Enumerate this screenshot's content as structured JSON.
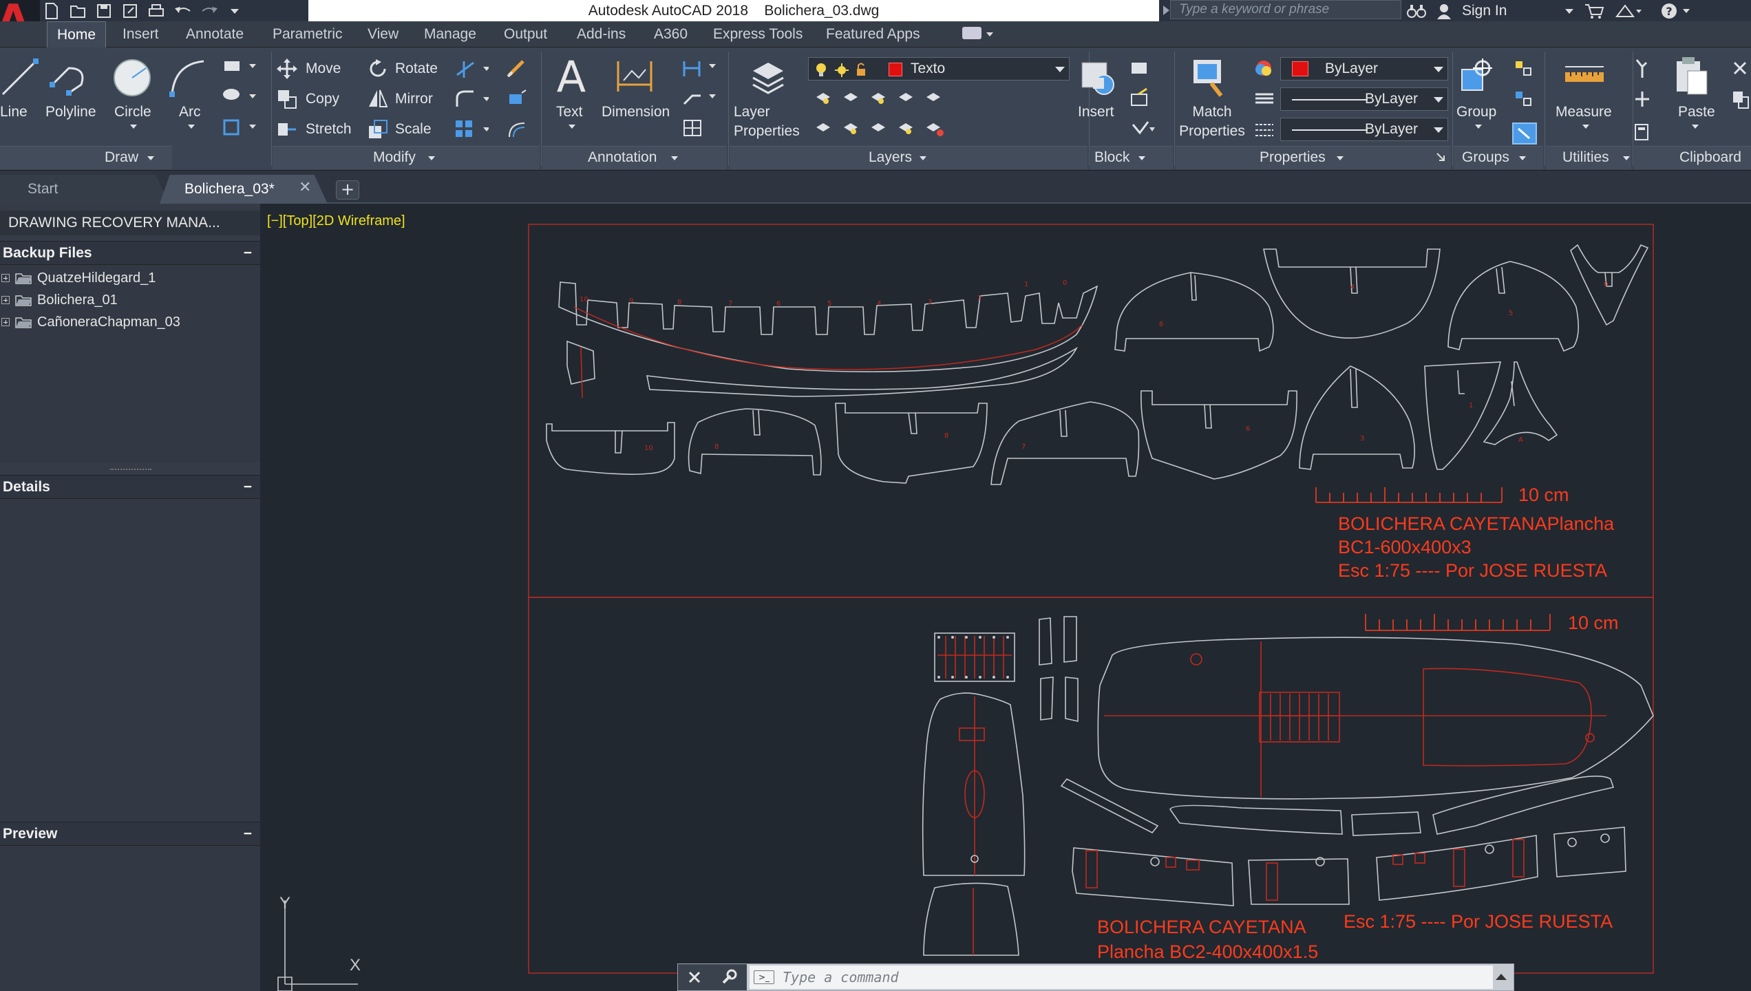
{
  "titlebar": {
    "title": "Autodesk AutoCAD 2018    Bolichera_03.dwg",
    "search_placeholder": "Type a keyword or phrase",
    "sign_in": "Sign In"
  },
  "ribbon_tabs": [
    "Home",
    "Insert",
    "Annotate",
    "Parametric",
    "View",
    "Manage",
    "Output",
    "Add-ins",
    "A360",
    "Express Tools",
    "Featured Apps"
  ],
  "ribbon": {
    "draw": {
      "label": "Draw",
      "line": "Line",
      "polyline": "Polyline",
      "circle": "Circle",
      "arc": "Arc"
    },
    "modify": {
      "label": "Modify",
      "move": "Move",
      "rotate": "Rotate",
      "copy": "Copy",
      "mirror": "Mirror",
      "stretch": "Stretch",
      "scale": "Scale"
    },
    "annotation": {
      "label": "Annotation",
      "text": "Text",
      "dimension": "Dimension"
    },
    "layers": {
      "label": "Layers",
      "layer_properties_1": "Layer",
      "layer_properties_2": "Properties",
      "current_layer": "Texto"
    },
    "block": {
      "label": "Block",
      "insert": "Insert"
    },
    "properties": {
      "label": "Properties",
      "match_1": "Match",
      "match_2": "Properties",
      "color": "ByLayer",
      "linetype": "ByLayer",
      "lineweight": "ByLayer"
    },
    "groups": {
      "label": "Groups",
      "group": "Group"
    },
    "utilities": {
      "label": "Utilities",
      "measure": "Measure"
    },
    "clipboard": {
      "label": "Clipboard",
      "paste": "Paste"
    }
  },
  "file_tabs": {
    "start": "Start",
    "current": "Bolichera_03*"
  },
  "palette": {
    "title": "DRAWING RECOVERY MANA...",
    "backup_header": "Backup Files",
    "backup_items": [
      "QuatzeHildegard_1",
      "Bolichera_01",
      "CañoneraChapman_03"
    ],
    "details_header": "Details",
    "preview_header": "Preview",
    "collapse": "−"
  },
  "viewport": {
    "label": "[−][Top][2D Wireframe]"
  },
  "drawing": {
    "sheet1_scale": "10 cm",
    "sheet1_title_1": "BOLICHERA CAYETANAPlancha",
    "sheet1_title_2": "BC1-600x400x3",
    "sheet1_title_3": "Esc 1:75 ---- Por JOSE RUESTA",
    "sheet2_scale": "10 cm",
    "sheet2_title_1": "BOLICHERA CAYETANA",
    "sheet2_title_2": "Plancha BC2-400x400x1.5",
    "sheet2_title_3": "Esc 1:75 ---- Por JOSE RUESTA",
    "ucs_x": "X",
    "ucs_y": "Y",
    "frame_numbers": [
      "10",
      "9",
      "8",
      "7",
      "6",
      "5",
      "4",
      "3",
      "2",
      "1",
      "0"
    ],
    "bottom_frame_numbers": [
      "10",
      "8",
      "8",
      "7",
      "6",
      "5",
      "3",
      "1",
      "A"
    ],
    "top_frame_numbers": [
      "6",
      "4",
      "5",
      "0"
    ]
  },
  "command": {
    "placeholder": "Type a command"
  },
  "colors": {
    "accent_red": "#e01010",
    "drawing_red": "#ff3a1a",
    "viewport_yellow": "#f1e21a"
  }
}
